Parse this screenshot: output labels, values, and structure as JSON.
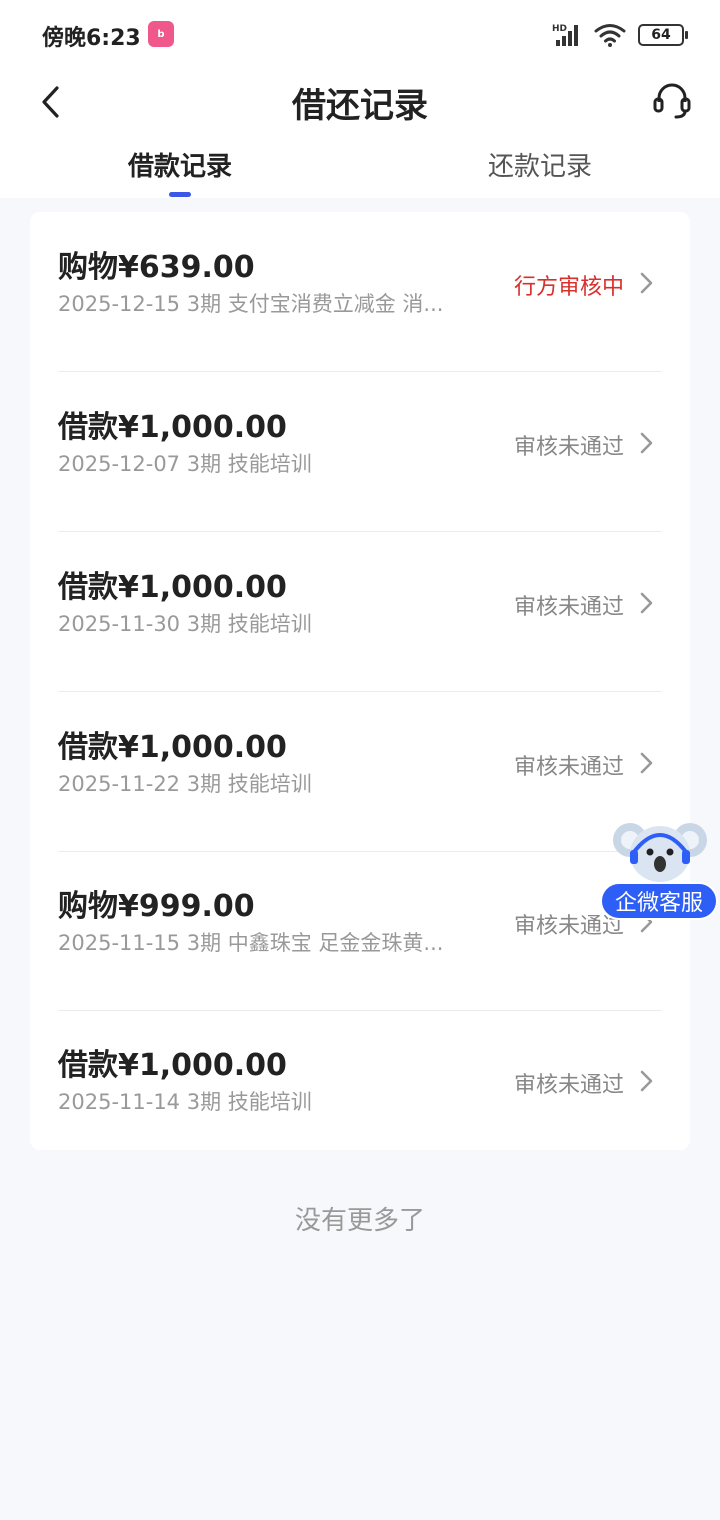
{
  "status_bar": {
    "time": "傍晚6:23",
    "app_badge": "bilibili",
    "network": "HD",
    "battery": "64"
  },
  "header": {
    "title": "借还记录"
  },
  "tabs": [
    {
      "label": "借款记录",
      "active": true
    },
    {
      "label": "还款记录",
      "active": false
    }
  ],
  "records": [
    {
      "title": "购物¥639.00",
      "subtitle": "2025-12-15 3期  支付宝消费立减金 消...",
      "status": "行方审核中"
    },
    {
      "title": "借款¥1,000.00",
      "subtitle": "2025-12-07 3期  技能培训",
      "status": "审核未通过"
    },
    {
      "title": "借款¥1,000.00",
      "subtitle": "2025-11-30 3期  技能培训",
      "status": "审核未通过"
    },
    {
      "title": "借款¥1,000.00",
      "subtitle": "2025-11-22 3期  技能培训",
      "status": "审核未通过"
    },
    {
      "title": "购物¥999.00",
      "subtitle": "2025-11-15 3期  中鑫珠宝 足金金珠黄...",
      "status": "审核未通过"
    },
    {
      "title": "借款¥1,000.00",
      "subtitle": "2025-11-14 3期  技能培训",
      "status": "审核未通过"
    }
  ],
  "footer": {
    "no_more": "没有更多了"
  },
  "floating": {
    "label": "企微客服"
  },
  "colors": {
    "accent": "#3a57e8",
    "pending": "#d9302c",
    "float_button": "#2d5ef5"
  }
}
